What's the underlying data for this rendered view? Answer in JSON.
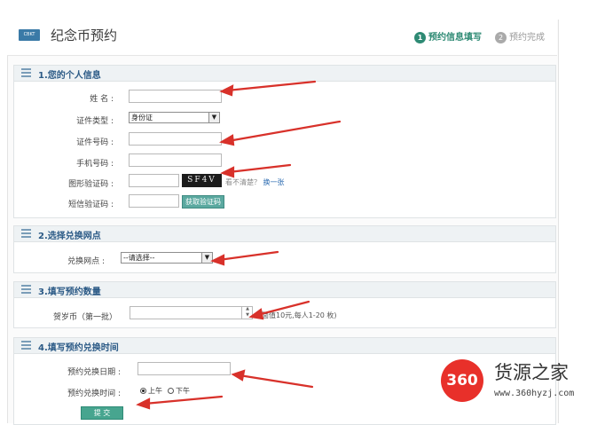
{
  "header": {
    "logo_text": "CBKT",
    "title": "纪念币预约",
    "steps": [
      {
        "num": "1",
        "label": "预约信息填写"
      },
      {
        "num": "2",
        "label": "预约完成"
      }
    ]
  },
  "section1": {
    "title": "1.您的个人信息",
    "name_label": "姓 名 :",
    "id_type_label": "证件类型 :",
    "id_type_value": "身份证",
    "id_number_label": "证件号码 :",
    "phone_label": "手机号码 :",
    "captcha_label": "图形验证码 :",
    "captcha_text": "SF4V",
    "captcha_hint": "看不清楚？",
    "captcha_refresh": "换一张",
    "sms_label": "短信验证码 :",
    "sms_button": "获取验证码"
  },
  "section2": {
    "title": "2.选择兑换网点",
    "branch_label": "兑换网点 :",
    "branch_value": "--请选择--"
  },
  "section3": {
    "title": "3.填写预约数量",
    "coin_label": "贺岁币（第一批）",
    "note": "（面值10元,每人1-20 枚)"
  },
  "section4": {
    "title": "4.填写预约兑换时间",
    "date_label": "预约兑换日期 :",
    "time_label": "预约兑换时间 :",
    "time_options": [
      "上午",
      "下午"
    ],
    "submit": "提 交"
  },
  "watermark": {
    "badge": "360",
    "name": "货源之家",
    "url": "www.360hyzj.com"
  }
}
